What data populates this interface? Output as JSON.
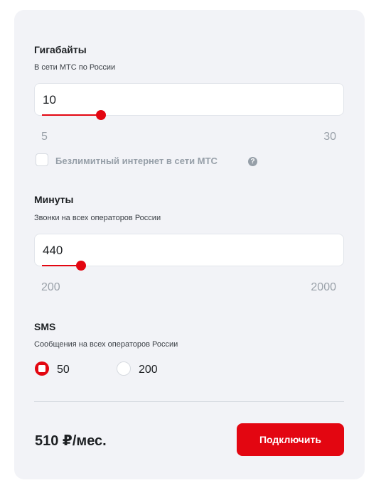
{
  "accent_color": "#e30611",
  "gigabytes": {
    "title": "Гигабайты",
    "subtitle": "В сети МТС по России",
    "value": "10",
    "min_label": "5",
    "max_label": "30",
    "min": 5,
    "max": 30,
    "current": 10
  },
  "unlimited": {
    "label": "Безлимитный интернет в сети МТС",
    "checked": false,
    "help_icon": "question-circle-icon",
    "help_glyph": "?"
  },
  "minutes": {
    "title": "Минуты",
    "subtitle": "Звонки на всех операторов России",
    "value": "440",
    "min_label": "200",
    "max_label": "2000",
    "min": 200,
    "max": 2000,
    "current": 440
  },
  "sms": {
    "title": "SMS",
    "subtitle": "Сообщения на всех операторов России",
    "options": [
      {
        "label": "50",
        "selected": true
      },
      {
        "label": "200",
        "selected": false
      }
    ]
  },
  "footer": {
    "price": "510 ₽/мес.",
    "connect_label": "Подключить"
  }
}
